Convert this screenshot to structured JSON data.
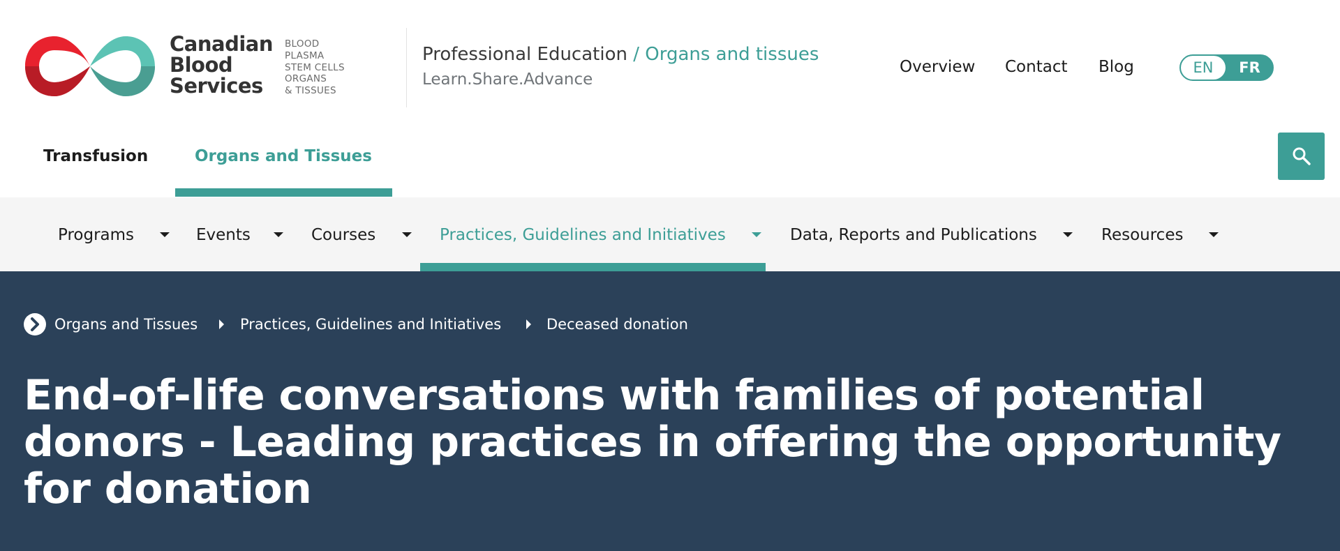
{
  "header": {
    "brand_lines": [
      "Canadian",
      "Blood",
      "Services"
    ],
    "brand_sub_lines": [
      "BLOOD",
      "PLASMA",
      "STEM CELLS",
      "ORGANS",
      "& TISSUES"
    ],
    "section_main": "Professional Education",
    "section_accent": " / Organs and tissues",
    "tagline": "Learn.Share.Advance",
    "utility_nav": {
      "overview": "Overview",
      "contact": "Contact",
      "blog": "Blog"
    },
    "lang": {
      "en": "EN",
      "fr": "FR"
    },
    "tabs": {
      "transfusion": "Transfusion",
      "organs": "Organs and Tissues"
    },
    "search_icon": "search-icon"
  },
  "subnav": {
    "items": [
      "Programs",
      "Events",
      "Courses",
      "Practices, Guidelines and Initiatives",
      "Data, Reports and Publications",
      "Resources"
    ],
    "active_index": 3
  },
  "hero": {
    "breadcrumb": [
      "Organs and Tissues",
      "Practices, Guidelines and Initiatives",
      "Deceased donation"
    ],
    "title": "End-of-life conversations with families of potential donors - Leading practices in offering the opportunity for donation"
  },
  "colors": {
    "accent": "#3d9e96",
    "hero_bg": "#2b4159",
    "logo_red": "#d42331",
    "logo_teal": "#5cc3b4"
  }
}
